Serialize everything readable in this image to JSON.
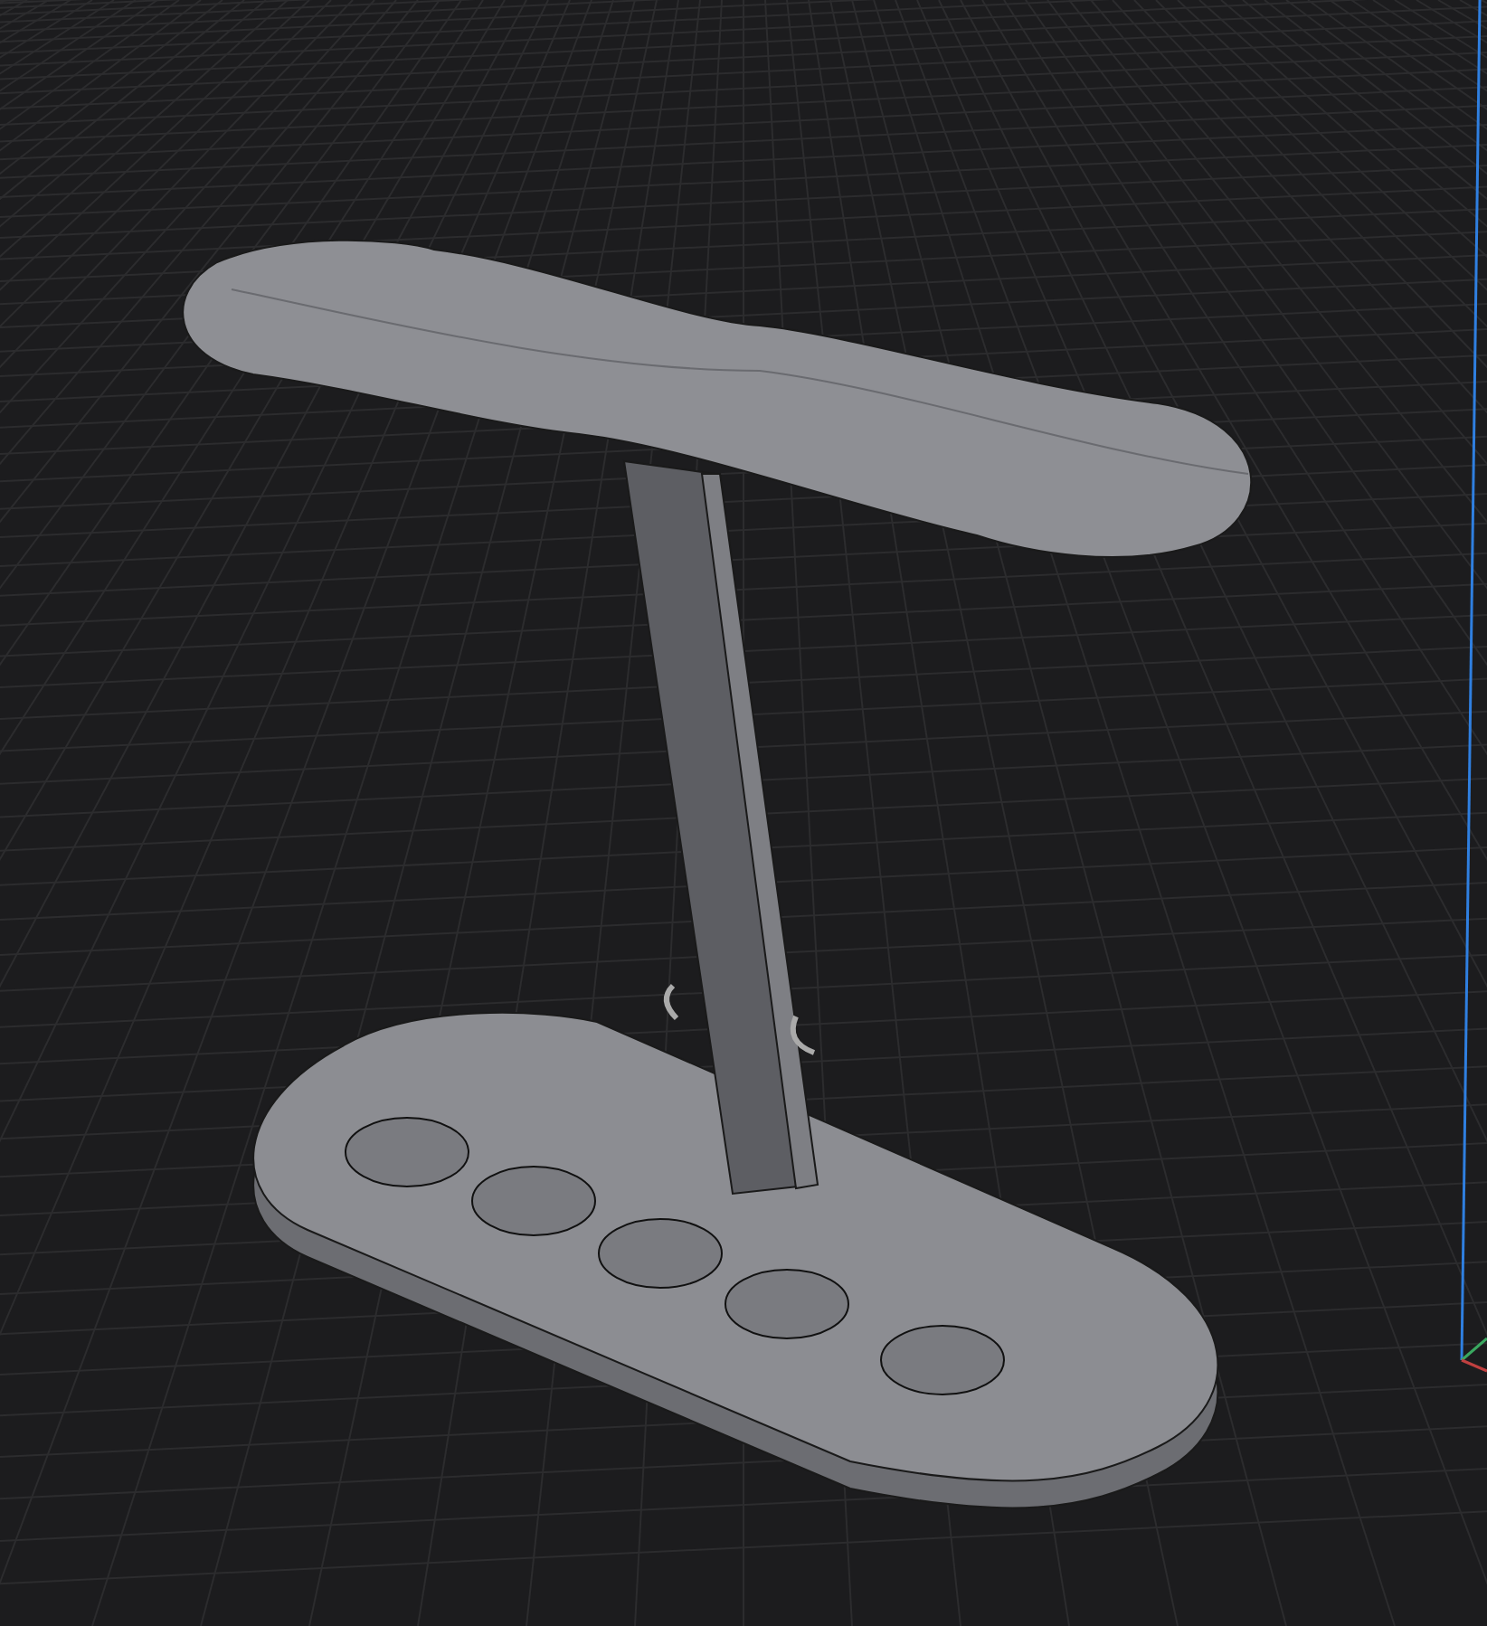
{
  "viewport": {
    "kind": "model",
    "show_axes": true,
    "show_grid": true
  }
}
